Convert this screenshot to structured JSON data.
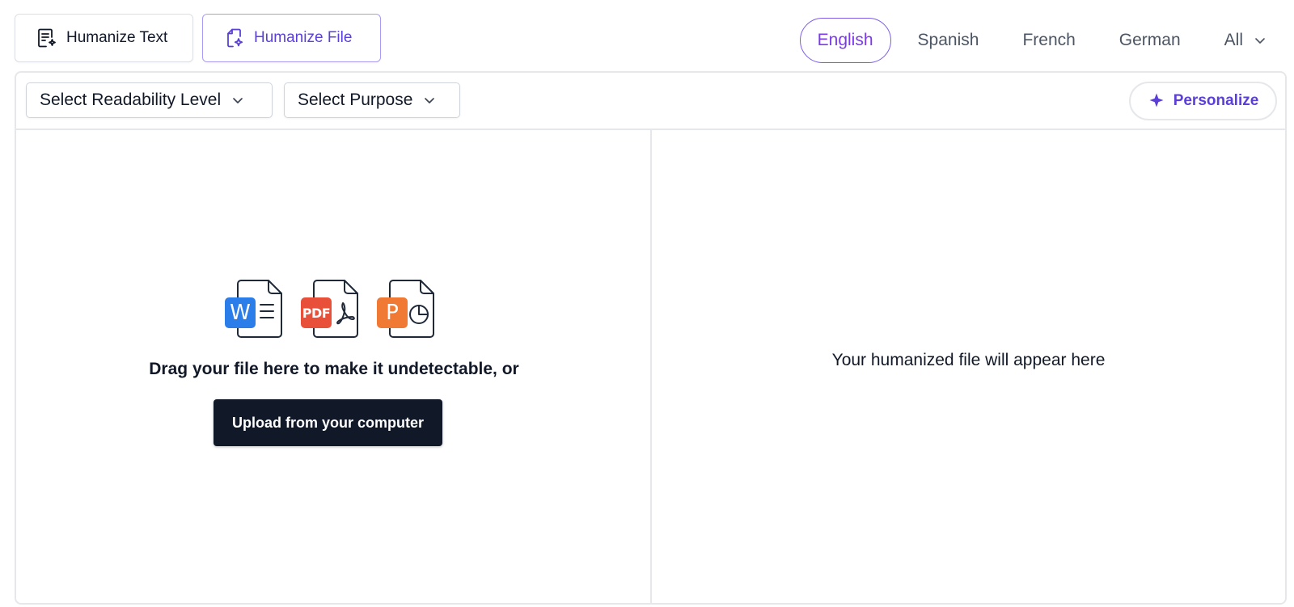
{
  "mode_tabs": {
    "text_label": "Humanize Text",
    "file_label": "Humanize File"
  },
  "languages": {
    "items": [
      "English",
      "Spanish",
      "French",
      "German"
    ],
    "active": "English",
    "all_label": "All"
  },
  "toolbar": {
    "readability_label": "Select Readability Level",
    "purpose_label": "Select Purpose",
    "personalize_label": "Personalize"
  },
  "upload": {
    "drag_text": "Drag your file here to make it undetectable, or",
    "button_label": "Upload from your computer",
    "file_types": [
      {
        "badge": "W",
        "color": "#2b7de9"
      },
      {
        "badge": "PDF",
        "color": "#e9503a"
      },
      {
        "badge": "P",
        "color": "#f07a34"
      }
    ]
  },
  "output": {
    "placeholder": "Your humanized file will appear here"
  },
  "colors": {
    "accent": "#5b3fd6",
    "active_lang": "#7c3aed",
    "button_dark": "#111827"
  }
}
